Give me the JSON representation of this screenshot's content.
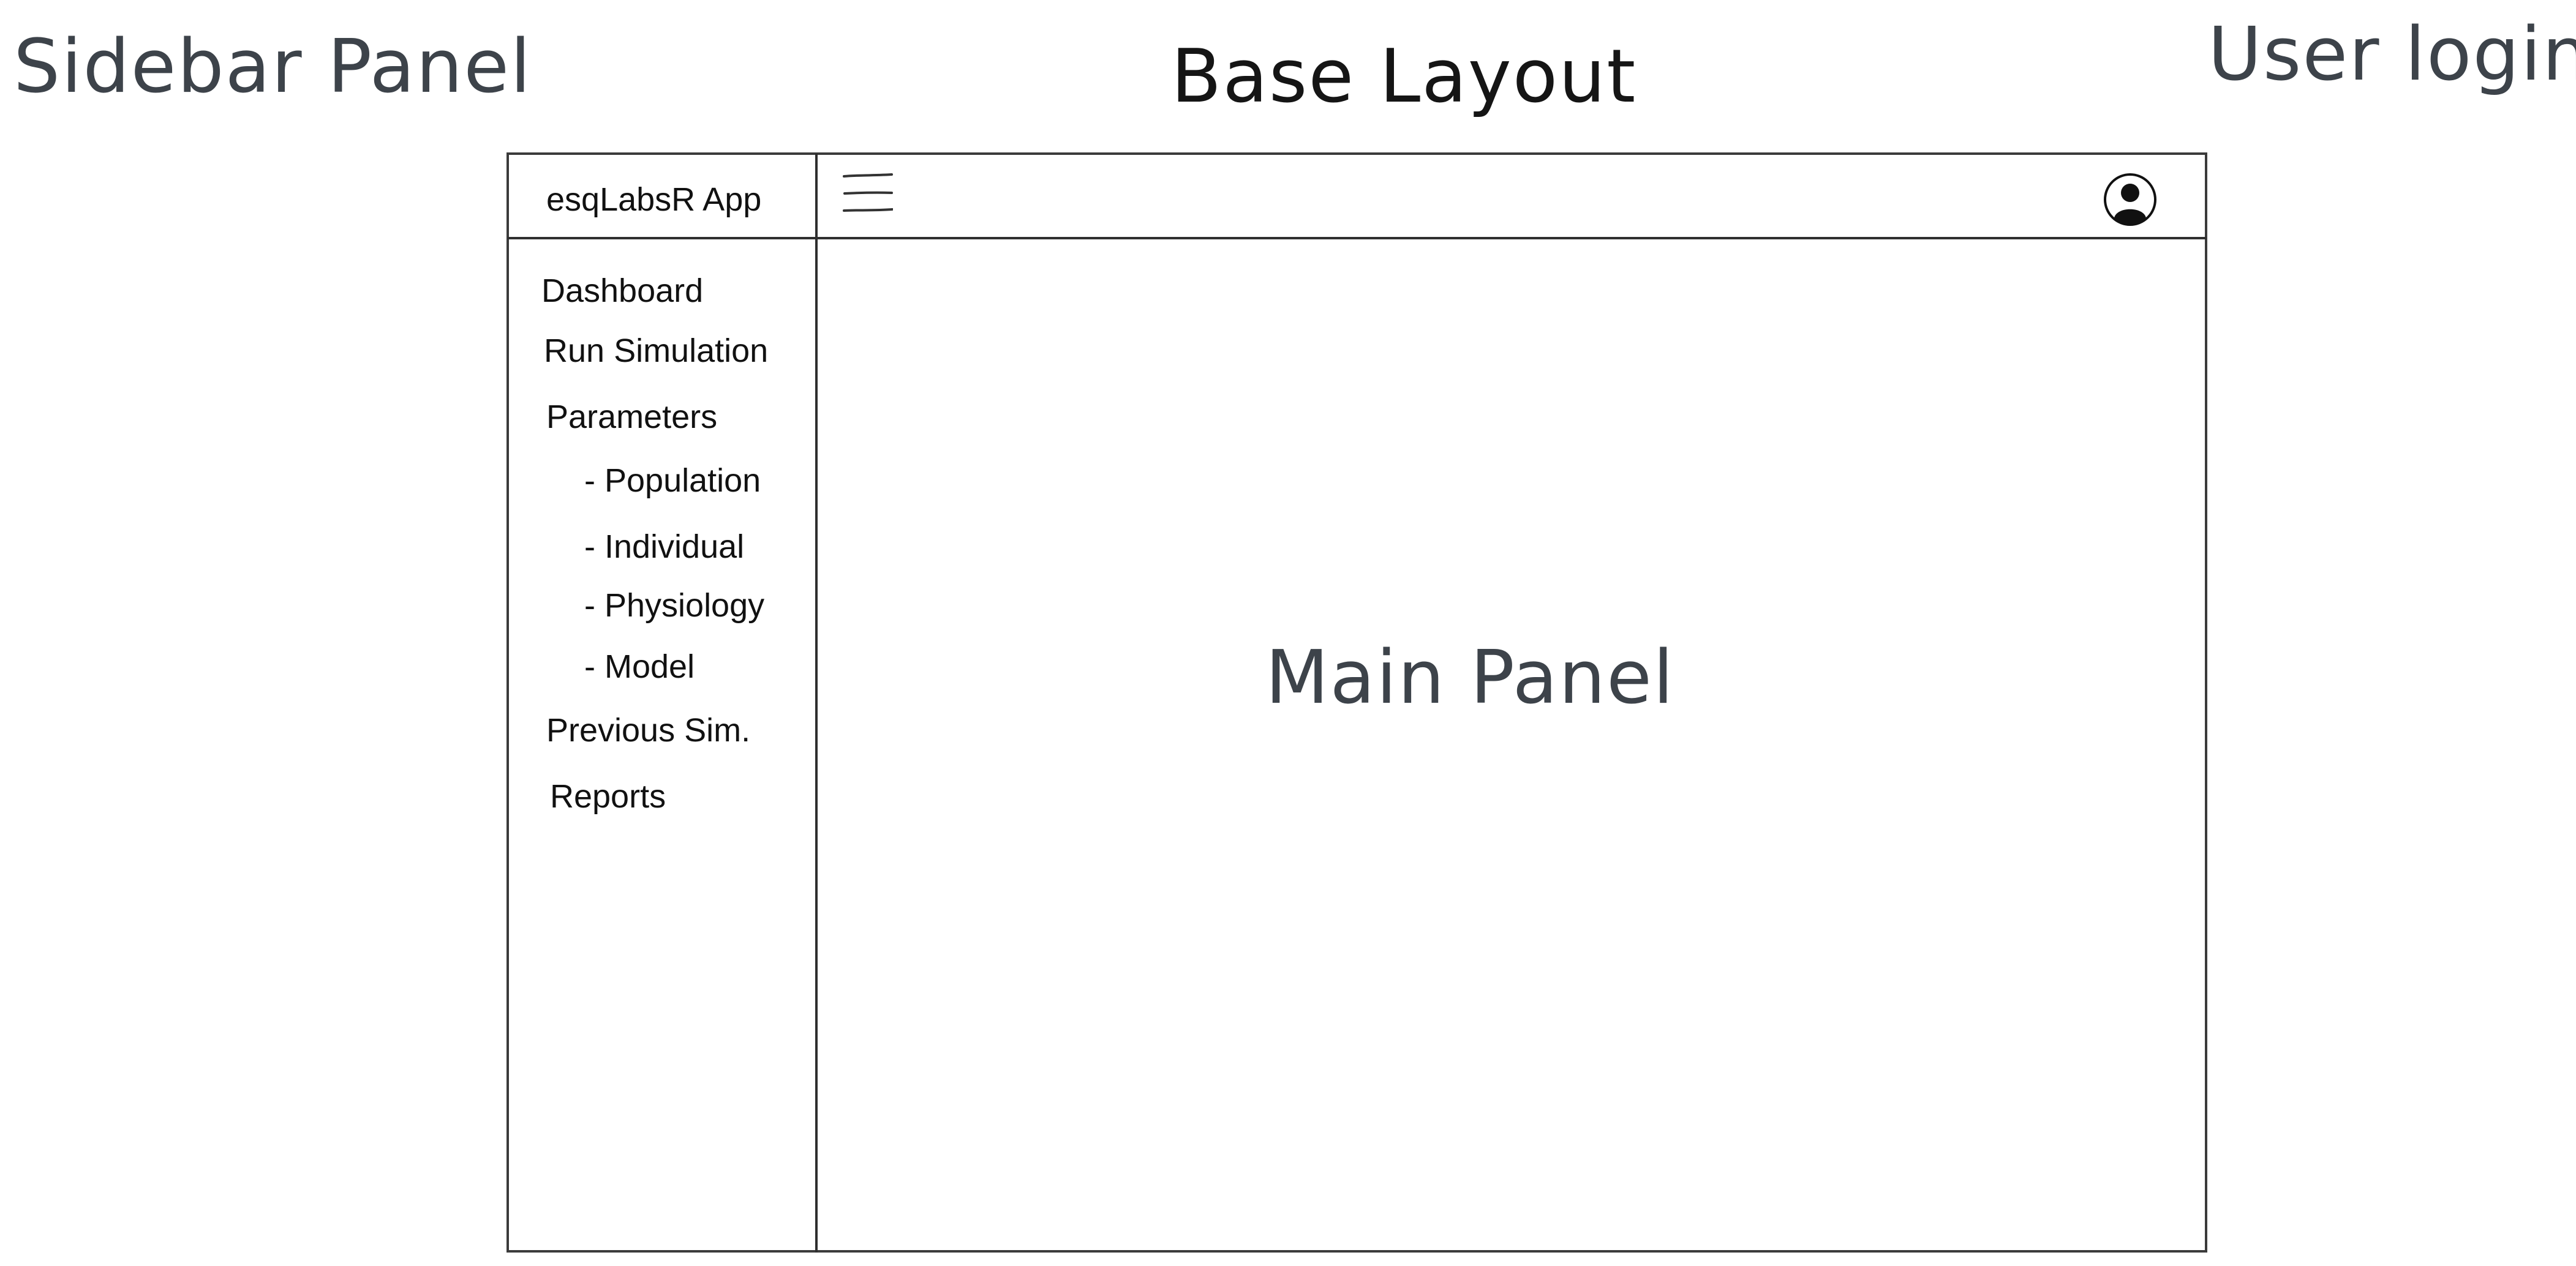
{
  "annotations": {
    "sidebar_panel": "Sidebar Panel",
    "base_layout": "Base Layout",
    "user_login": "User login",
    "main_panel": "Main Panel"
  },
  "app": {
    "brand": "esqLabsR App"
  },
  "header": {
    "menu_icon": "hamburger-menu-icon",
    "user_icon": "user-avatar-icon"
  },
  "sidebar": {
    "items": [
      {
        "label": "Dashboard"
      },
      {
        "label": "Run Simulation"
      },
      {
        "label": "Parameters"
      },
      {
        "label": "- Population"
      },
      {
        "label": "- Individual"
      },
      {
        "label": "- Physiology"
      },
      {
        "label": "- Model"
      },
      {
        "label": "Previous Sim."
      },
      {
        "label": "Reports"
      }
    ]
  },
  "colors": {
    "annotation": "#3d434a",
    "outline": "#2f2f2f",
    "text": "#111111",
    "background": "#ffffff"
  }
}
